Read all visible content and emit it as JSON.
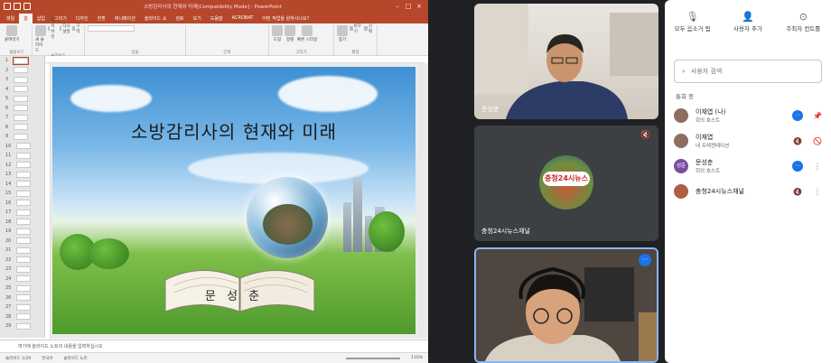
{
  "ppt": {
    "doc_title": "소방감리사의 현재와 미래[Compatibility Mode] - PowerPoint",
    "tabs": [
      "파일",
      "홈",
      "삽입",
      "그리기",
      "디자인",
      "전환",
      "애니메이션",
      "슬라이드 쇼",
      "검토",
      "보기",
      "도움말",
      "ACROBAT",
      "어떤 작업을 원하시나요?"
    ],
    "active_tab_index": 1,
    "groups": [
      {
        "label": "클립보드",
        "items": [
          "붙여넣기"
        ]
      },
      {
        "label": "슬라이드",
        "items": [
          "새 슬라이드",
          "레이아웃",
          "다시 설정",
          "구역"
        ]
      },
      {
        "label": "글꼴",
        "items": []
      },
      {
        "label": "단락",
        "items": []
      },
      {
        "label": "그리기",
        "items": [
          "도형",
          "정렬",
          "빠른 스타일"
        ]
      },
      {
        "label": "편집",
        "items": [
          "찾기",
          "바꾸기",
          "선택"
        ]
      }
    ],
    "slide_numbers": [
      "1",
      "2",
      "3",
      "4",
      "5",
      "6",
      "7",
      "8",
      "9",
      "10",
      "11",
      "12",
      "13",
      "14",
      "15",
      "16",
      "17",
      "18",
      "19",
      "20",
      "21",
      "22",
      "23",
      "24",
      "25",
      "26",
      "27",
      "28",
      "29"
    ],
    "selected_slide": "1",
    "slide_title": "소방감리사의 현재와 미래",
    "slide_author": "문 성 춘",
    "notes_placeholder": "여기에 슬라이드 노트의 내용을 입력하십시오",
    "status": {
      "slide_info": "슬라이드 1/29",
      "language": "한국어",
      "notes": "슬라이드 노트",
      "zoom": "110%"
    }
  },
  "tiles": [
    {
      "name": "문성춘",
      "muted": false
    },
    {
      "name": "충청24시뉴스채널",
      "muted": true,
      "badge": "충청24시뉴스"
    },
    {
      "name": "",
      "muted": false,
      "more": "⋯"
    }
  ],
  "panel": {
    "actions": [
      {
        "icon": "mic-off-icon",
        "glyph": "🎙",
        "label": "모두 음소거 됨"
      },
      {
        "icon": "add-person-icon",
        "glyph": "👤",
        "label": "사용자 추가"
      },
      {
        "icon": "toggle-icon",
        "glyph": "⊙",
        "label": "주최자 컨트롤"
      }
    ],
    "search_placeholder": "사용자 검색",
    "section_title": "통화 중",
    "participants": [
      {
        "name": "이재엽 (나)",
        "role": "회의 호스트",
        "avatar": "",
        "avatar_color": "#8d6e63",
        "icons": [
          "⋯",
          "📌"
        ]
      },
      {
        "name": "이재엽",
        "role": "내 프레젠테이션",
        "avatar": "",
        "avatar_color": "#8d6e63",
        "icons": [
          "🔇",
          "🚫"
        ]
      },
      {
        "name": "문성춘",
        "role": "회의 호스트",
        "avatar": "성춘",
        "avatar_color": "#7b4c9e",
        "icons": [
          "⋯",
          "⋮"
        ]
      },
      {
        "name": "충청24시뉴스채널",
        "role": "",
        "avatar": "",
        "avatar_color": "#b05d43",
        "icons": [
          "🔇",
          "⋮"
        ]
      }
    ]
  }
}
